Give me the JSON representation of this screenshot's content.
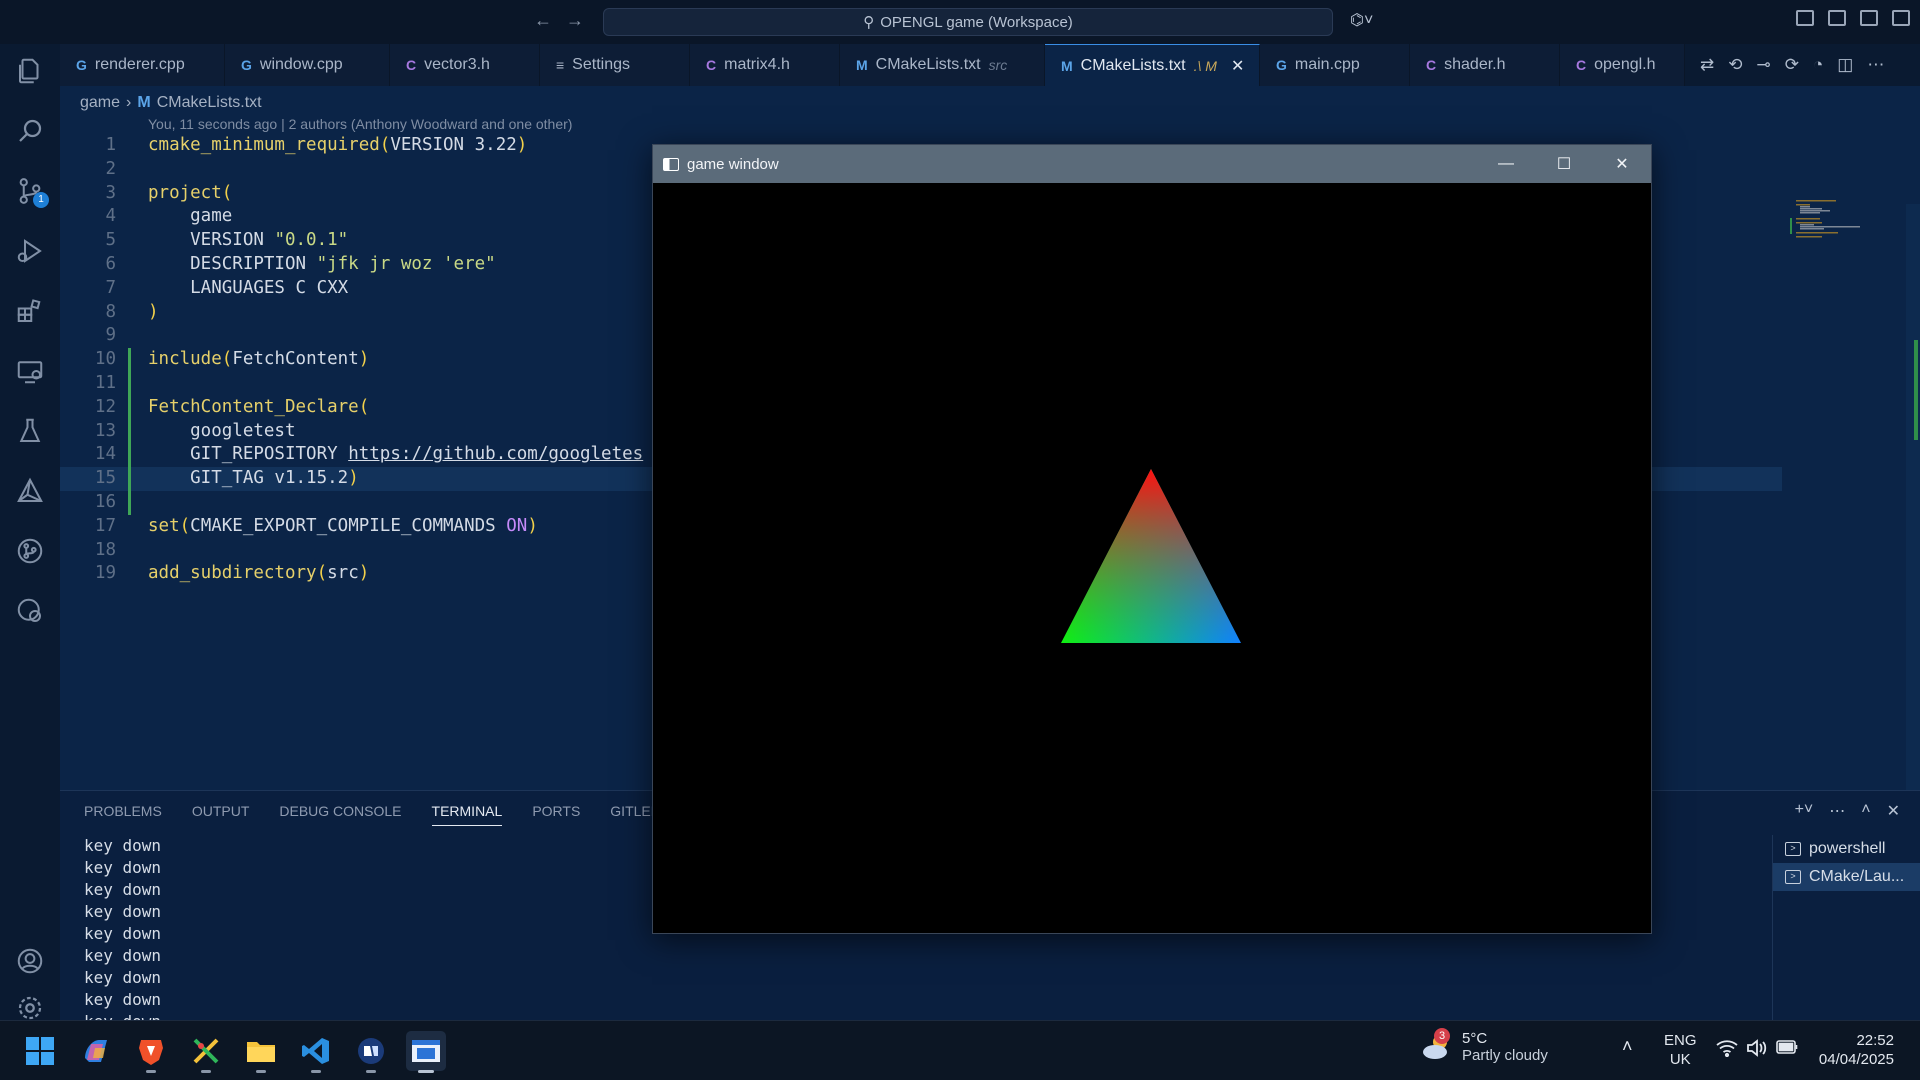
{
  "titlebar": {
    "search_text": "OPENGL game (Workspace)"
  },
  "tabs": [
    {
      "icon": "G",
      "kind": "cpp",
      "label": "renderer.cpp",
      "desc": ""
    },
    {
      "icon": "G",
      "kind": "cpp",
      "label": "window.cpp",
      "desc": ""
    },
    {
      "icon": "C",
      "kind": "c",
      "label": "vector3.h",
      "desc": ""
    },
    {
      "icon": "≡",
      "kind": "s",
      "label": "Settings",
      "desc": ""
    },
    {
      "icon": "C",
      "kind": "c",
      "label": "matrix4.h",
      "desc": ""
    },
    {
      "icon": "M",
      "kind": "m",
      "label": "CMakeLists.txt",
      "desc": "src"
    },
    {
      "icon": "M",
      "kind": "m",
      "label": "CMakeLists.txt",
      "desc": ".\\ M"
    },
    {
      "icon": "G",
      "kind": "cpp",
      "label": "main.cpp",
      "desc": ""
    },
    {
      "icon": "C",
      "kind": "c",
      "label": "shader.h",
      "desc": ""
    },
    {
      "icon": "C",
      "kind": "c",
      "label": "opengl.h",
      "desc": ""
    }
  ],
  "active_tab_index": 6,
  "breadcrumb": {
    "folder": "game",
    "file_icon": "M",
    "file": "CMakeLists.txt"
  },
  "blame": "You, 11 seconds ago | 2 authors (Anthony Woodward and one other)",
  "source_control_badge": "1",
  "code_lines": [
    {
      "n": "1",
      "tokens": [
        [
          "fn",
          "cmake_minimum_required"
        ],
        [
          "paren",
          "("
        ],
        [
          "txt",
          "VERSION 3.22"
        ],
        [
          "paren",
          ")"
        ]
      ]
    },
    {
      "n": "2",
      "tokens": []
    },
    {
      "n": "3",
      "tokens": [
        [
          "fn",
          "project"
        ],
        [
          "paren",
          "("
        ]
      ]
    },
    {
      "n": "4",
      "tokens": [
        [
          "txt",
          "    game"
        ]
      ]
    },
    {
      "n": "5",
      "tokens": [
        [
          "txt",
          "    VERSION "
        ],
        [
          "str",
          "\"0.0.1\""
        ]
      ]
    },
    {
      "n": "6",
      "tokens": [
        [
          "txt",
          "    DESCRIPTION "
        ],
        [
          "str",
          "\"jfk jr woz 'ere\""
        ]
      ]
    },
    {
      "n": "7",
      "tokens": [
        [
          "txt",
          "    LANGUAGES C CXX"
        ]
      ]
    },
    {
      "n": "8",
      "tokens": [
        [
          "paren",
          ")"
        ]
      ]
    },
    {
      "n": "9",
      "tokens": []
    },
    {
      "n": "10",
      "tokens": [
        [
          "fn",
          "include"
        ],
        [
          "paren",
          "("
        ],
        [
          "txt",
          "FetchContent"
        ],
        [
          "paren",
          ")"
        ]
      ]
    },
    {
      "n": "11",
      "tokens": []
    },
    {
      "n": "12",
      "tokens": [
        [
          "fn",
          "FetchContent_Declare"
        ],
        [
          "paren",
          "("
        ]
      ]
    },
    {
      "n": "13",
      "tokens": [
        [
          "txt",
          "    googletest"
        ]
      ]
    },
    {
      "n": "14",
      "tokens": [
        [
          "txt",
          "    GIT_REPOSITORY "
        ],
        [
          "url",
          "https://github.com/googletes"
        ]
      ]
    },
    {
      "n": "15",
      "tokens": [
        [
          "txt",
          "    GIT_TAG v1.15.2"
        ],
        [
          "paren",
          ")"
        ]
      ]
    },
    {
      "n": "16",
      "tokens": []
    },
    {
      "n": "17",
      "tokens": [
        [
          "fn",
          "set"
        ],
        [
          "paren",
          "("
        ],
        [
          "txt",
          "CMAKE_EXPORT_COMPILE_COMMANDS "
        ],
        [
          "kw",
          "ON"
        ],
        [
          "paren",
          ")"
        ]
      ]
    },
    {
      "n": "18",
      "tokens": []
    },
    {
      "n": "19",
      "tokens": [
        [
          "fn",
          "add_subdirectory"
        ],
        [
          "paren",
          "("
        ],
        [
          "txt",
          "src"
        ],
        [
          "paren",
          ")"
        ]
      ]
    }
  ],
  "panel": {
    "tabs": [
      "PROBLEMS",
      "OUTPUT",
      "DEBUG CONSOLE",
      "TERMINAL",
      "PORTS",
      "GITLENS"
    ],
    "active_tab": "TERMINAL",
    "terminal_lines": [
      "key down",
      "key down",
      "key down",
      "key down",
      "key down",
      "key down",
      "key down",
      "key down",
      "key down"
    ],
    "terminals": [
      "powershell",
      "CMake/Lau..."
    ]
  },
  "game_window": {
    "title": "game window"
  },
  "taskbar": {
    "weather_temp": "5°C",
    "weather_desc": "Partly cloudy",
    "weather_badge": "3",
    "lang_top": "ENG",
    "lang_bottom": "UK",
    "time": "22:52",
    "date": "04/04/2025"
  }
}
